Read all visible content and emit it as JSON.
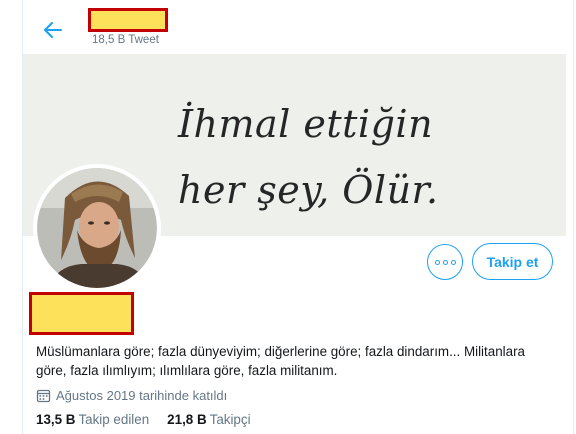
{
  "header": {
    "tweet_count": "18,5 B Tweet"
  },
  "banner": {
    "line1": "İhmal ettiğin",
    "line2": "her şey, Ölür."
  },
  "profile": {
    "bio": "Müslümanlara göre; fazla dünyeviyim; diğerlerine göre; fazla dindarım... Militanlara göre, fazla ılımlıyım; ılımlılara göre, fazla militanım.",
    "joined": "Ağustos 2019 tarihinde katıldı",
    "following_count": "13,5 B",
    "following_label": "Takip edilen",
    "followers_count": "21,8 B",
    "followers_label": "Takipçi"
  },
  "actions": {
    "follow_label": "Takip et"
  },
  "colors": {
    "accent": "#1da1f2",
    "secondary_text": "#657786",
    "redaction_fill": "#fde15a",
    "redaction_border": "#c20000"
  },
  "icons": {
    "back": "arrow-left-icon",
    "more": "more-horizontal-icon",
    "calendar": "calendar-icon"
  }
}
